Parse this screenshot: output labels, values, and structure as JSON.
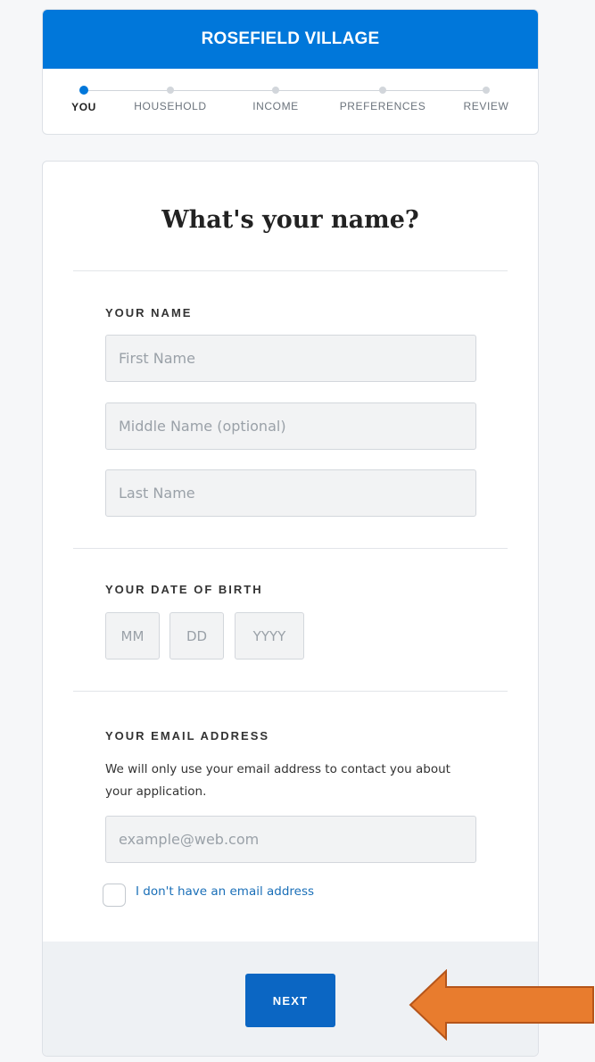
{
  "brand": {
    "title": "ROSEFIELD VILLAGE"
  },
  "stepper": {
    "steps": [
      {
        "label": "YOU",
        "active": true
      },
      {
        "label": "HOUSEHOLD",
        "active": false
      },
      {
        "label": "INCOME",
        "active": false
      },
      {
        "label": "PREFERENCES",
        "active": false
      },
      {
        "label": "REVIEW",
        "active": false
      }
    ]
  },
  "form": {
    "title": "What's your name?",
    "name_section": {
      "label": "YOUR NAME",
      "first_placeholder": "First Name",
      "middle_placeholder": "Middle Name (optional)",
      "last_placeholder": "Last Name"
    },
    "dob_section": {
      "label": "YOUR DATE OF BIRTH",
      "month_placeholder": "MM",
      "day_placeholder": "DD",
      "year_placeholder": "YYYY"
    },
    "email_section": {
      "label": "YOUR EMAIL ADDRESS",
      "helper": "We will only use your email address to contact you about your application.",
      "email_placeholder": "example@web.com",
      "no_email_label": "I don't have an email address"
    },
    "next_label": "NEXT"
  },
  "colors": {
    "brand": "#0077da",
    "button": "#0b66c3",
    "link": "#1a6fb8",
    "annotation_arrow": "#e87c2e"
  }
}
